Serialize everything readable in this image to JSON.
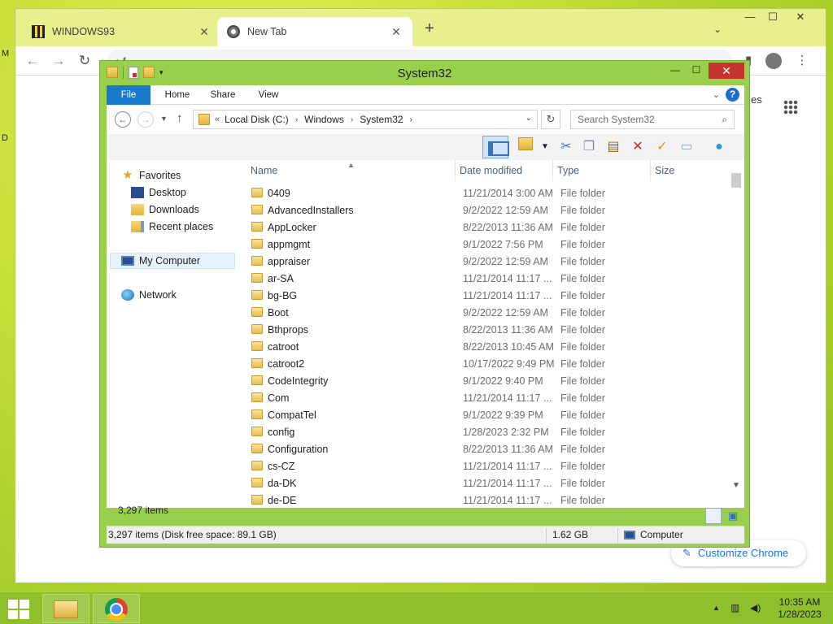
{
  "desktop": {
    "label_m": "M",
    "label_d": "D"
  },
  "chrome": {
    "tabs": [
      {
        "title": "WINDOWS93"
      },
      {
        "title": "New Tab"
      }
    ],
    "new_tab": "+",
    "tab_search": "⌄",
    "window_controls": {
      "minimize": "—",
      "maximize": "☐",
      "close": "✕"
    },
    "nav": {
      "back": "←",
      "forward": "→",
      "reload": "↻"
    },
    "omnibox_value": "f",
    "ntp_link_fragment": "es",
    "customize_label": "Customize Chrome"
  },
  "explorer": {
    "title": "System32",
    "window_controls": {
      "minimize": "—",
      "maximize": "☐",
      "close": "✕"
    },
    "ribbon_tabs": [
      "File",
      "Home",
      "Share",
      "View"
    ],
    "breadcrumbs": [
      "Local Disk (C:)",
      "Windows",
      "System32"
    ],
    "breadcrumb_overflow": "«",
    "search_placeholder": "Search System32",
    "nav_pane": {
      "favorites": "Favorites",
      "favorites_items": [
        "Desktop",
        "Downloads",
        "Recent places"
      ],
      "computer": "My Computer",
      "network": "Network"
    },
    "columns": [
      "Name",
      "Date modified",
      "Type",
      "Size"
    ],
    "files": [
      {
        "name": "0409",
        "date": "11/21/2014 3:00 AM",
        "type": "File folder"
      },
      {
        "name": "AdvancedInstallers",
        "date": "9/2/2022 12:59 AM",
        "type": "File folder"
      },
      {
        "name": "AppLocker",
        "date": "8/22/2013 11:36 AM",
        "type": "File folder"
      },
      {
        "name": "appmgmt",
        "date": "9/1/2022 7:56 PM",
        "type": "File folder"
      },
      {
        "name": "appraiser",
        "date": "9/2/2022 12:59 AM",
        "type": "File folder"
      },
      {
        "name": "ar-SA",
        "date": "11/21/2014 11:17 ...",
        "type": "File folder"
      },
      {
        "name": "bg-BG",
        "date": "11/21/2014 11:17 ...",
        "type": "File folder"
      },
      {
        "name": "Boot",
        "date": "9/2/2022 12:59 AM",
        "type": "File folder"
      },
      {
        "name": "Bthprops",
        "date": "8/22/2013 11:36 AM",
        "type": "File folder"
      },
      {
        "name": "catroot",
        "date": "8/22/2013 10:45 AM",
        "type": "File folder"
      },
      {
        "name": "catroot2",
        "date": "10/17/2022 9:49 PM",
        "type": "File folder"
      },
      {
        "name": "CodeIntegrity",
        "date": "9/1/2022 9:40 PM",
        "type": "File folder"
      },
      {
        "name": "Com",
        "date": "11/21/2014 11:17 ...",
        "type": "File folder"
      },
      {
        "name": "CompatTel",
        "date": "9/1/2022 9:39 PM",
        "type": "File folder"
      },
      {
        "name": "config",
        "date": "1/28/2023 2:32 PM",
        "type": "File folder"
      },
      {
        "name": "Configuration",
        "date": "8/22/2013 11:36 AM",
        "type": "File folder"
      },
      {
        "name": "cs-CZ",
        "date": "11/21/2014 11:17 ...",
        "type": "File folder"
      },
      {
        "name": "da-DK",
        "date": "11/21/2014 11:17 ...",
        "type": "File folder"
      },
      {
        "name": "de-DE",
        "date": "11/21/2014 11:17 ...",
        "type": "File folder"
      }
    ],
    "item_count": "3,297 items",
    "status": {
      "summary": "3,297 items (Disk free space: 89.1 GB)",
      "size": "1.62 GB",
      "location": "Computer"
    }
  },
  "taskbar": {
    "time": "10:35 AM",
    "date": "1/28/2023",
    "tray_up": "▲"
  }
}
